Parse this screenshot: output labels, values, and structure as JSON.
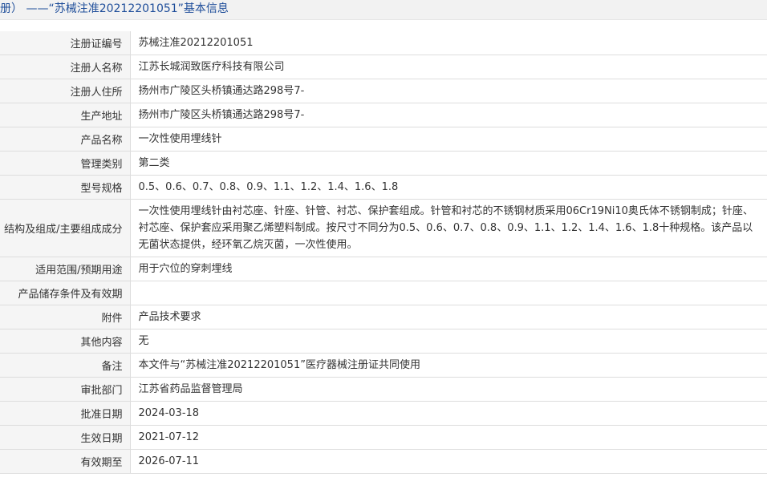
{
  "header": {
    "title": "册） ——“苏械注准20212201051”基本信息"
  },
  "rows": [
    {
      "label": "注册证编号",
      "value": "苏械注准20212201051"
    },
    {
      "label": "注册人名称",
      "value": "江苏长城润致医疗科技有限公司"
    },
    {
      "label": "注册人住所",
      "value": "扬州市广陵区头桥镇通达路298号7-"
    },
    {
      "label": "生产地址",
      "value": "扬州市广陵区头桥镇通达路298号7-"
    },
    {
      "label": "产品名称",
      "value": "一次性使用埋线针"
    },
    {
      "label": "管理类别",
      "value": "第二类"
    },
    {
      "label": "型号规格",
      "value": "0.5、0.6、0.7、0.8、0.9、1.1、1.2、1.4、1.6、1.8"
    },
    {
      "label": "结构及组成/主要组成成分",
      "value": "一次性使用埋线针由衬芯座、针座、针管、衬芯、保护套组成。针管和衬芯的不锈钢材质采用06Cr19Ni10奥氏体不锈钢制成；针座、衬芯座、保护套应采用聚乙烯塑料制成。按尺寸不同分为0.5、0.6、0.7、0.8、0.9、1.1、1.2、1.4、1.6、1.8十种规格。该产品以无菌状态提供，经环氧乙烷灭菌，一次性使用。"
    },
    {
      "label": "适用范围/预期用途",
      "value": "用于穴位的穿刺埋线"
    },
    {
      "label": "产品储存条件及有效期",
      "value": ""
    },
    {
      "label": "附件",
      "value": "产品技术要求"
    },
    {
      "label": "其他内容",
      "value": "无"
    },
    {
      "label": "备注",
      "value": "本文件与“苏械注准20212201051”医疗器械注册证共同使用"
    },
    {
      "label": "审批部门",
      "value": "江苏省药品监督管理局"
    },
    {
      "label": "批准日期",
      "value": "2024-03-18"
    },
    {
      "label": "生效日期",
      "value": "2021-07-12"
    },
    {
      "label": "有效期至",
      "value": "2026-07-11"
    }
  ]
}
